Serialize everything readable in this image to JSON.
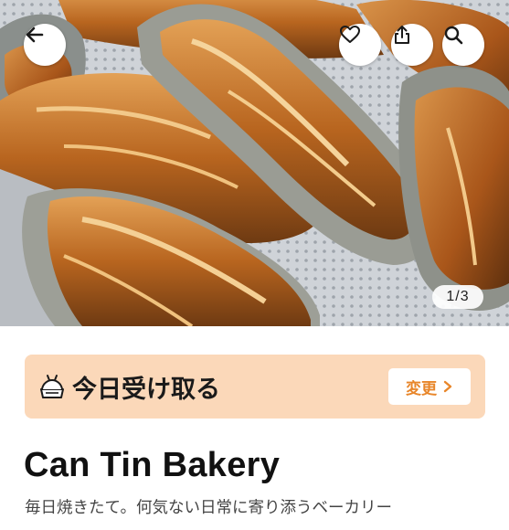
{
  "hero": {
    "image_alt": "baguettes-on-baking-tray-photo",
    "counter": "1/3"
  },
  "header": {
    "back_icon": "arrow-left-icon",
    "favorite_icon": "heart-icon",
    "share_icon": "share-icon",
    "search_icon": "search-icon"
  },
  "pickup": {
    "icon": "takeout-bag-icon",
    "label": "今日受け取る",
    "change_label": "変更",
    "change_icon": "chevron-right-icon"
  },
  "shop": {
    "name": "Can Tin Bakery",
    "tagline": "毎日焼きたて。何気ない日常に寄り添うベーカリー"
  },
  "colors": {
    "pickup_bg": "#fbd8b9",
    "accent": "#e8862a",
    "title_text": "#111111"
  }
}
